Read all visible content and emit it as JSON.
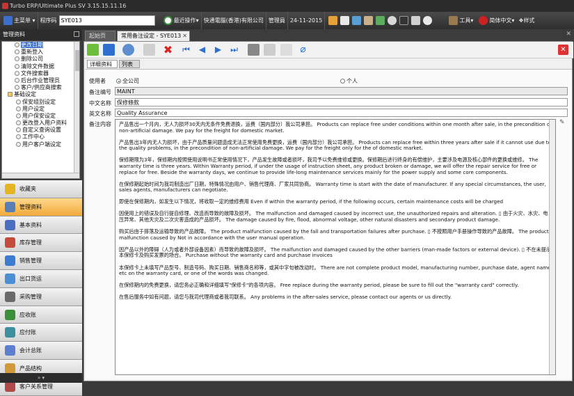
{
  "window": {
    "title": "Turbo ERP/Ultimate Plus SV 3.15.15.11.16"
  },
  "toolbar": {
    "main_menu": "主菜单",
    "program_code_label": "程序码",
    "program_code_value": "SYE013",
    "recent_ops": "最近操作",
    "company": "快通電腦(香港)有限公司",
    "user": "管理員",
    "date": "24-11-2015",
    "tools": "工具",
    "language": "简体中文",
    "style": "样式"
  },
  "sidebar": {
    "title": "管理资料",
    "tree": [
      {
        "label": "更改日期",
        "selected": true
      },
      {
        "label": "重新登入"
      },
      {
        "label": "删除公司"
      },
      {
        "label": "清除文件数据"
      },
      {
        "label": "文件搜索器"
      },
      {
        "label": "后台作业管理员"
      },
      {
        "label": "客户/供应商搜索"
      },
      {
        "label": "基础设定"
      },
      {
        "label": "保安组别设定"
      },
      {
        "label": "用户设定"
      },
      {
        "label": "用户保安设定"
      },
      {
        "label": "更改登入用户资料"
      },
      {
        "label": "自定义查询设置"
      },
      {
        "label": "工作中心"
      },
      {
        "label": "用户客户端设定"
      }
    ],
    "modules": [
      {
        "label": "收藏夹",
        "color": "#e6b422"
      },
      {
        "label": "管理资料",
        "color": "#5a7fb5",
        "active": true
      },
      {
        "label": "基本资料",
        "color": "#4a6fc0"
      },
      {
        "label": "库存管理",
        "color": "#c44b3c"
      },
      {
        "label": "销售管理",
        "color": "#3b7bd0"
      },
      {
        "label": "出口货运",
        "color": "#4b8fd6"
      },
      {
        "label": "采购管理",
        "color": "#6a6a6a"
      },
      {
        "label": "应收账",
        "color": "#3b8f3b"
      },
      {
        "label": "应付账",
        "color": "#3b8f9f"
      },
      {
        "label": "会计总账",
        "color": "#5c7fd0"
      },
      {
        "label": "产品结构",
        "color": "#d09a3b"
      },
      {
        "label": "客户关系管理",
        "color": "#b04a4a"
      }
    ]
  },
  "doc_tabs": {
    "home": "起始页",
    "current": "常用备注设定 - SYE013"
  },
  "sub_tabs": {
    "detail": "详细资料",
    "list": "列表"
  },
  "form": {
    "usage_label": "使用者",
    "opt_all": "全公司",
    "opt_personal": "个人",
    "code_label": "备注编号",
    "code_value": "MAINT",
    "name_cn_label": "中文名称",
    "name_cn_value": "保修條款",
    "name_en_label": "英文名称",
    "name_en_value": "Quality Assurance",
    "content_label": "备注内容",
    "content": [
      "产品售出一个月内，无人为损坏30天内无条件免费退换，运费（国内部分）我公司承担。 Products can replace free under conditions within one month after sale, in the precondition of non-artificial damage. We pay for the freight for domestic market.",
      "产品售出3年内无人为损坏，由于产品质量问题造成无法正常使用免费更换，运费（国内部分）我公司承担。 Products can replace free within three years after sale if it cannot use due to the quality problems, in the precondition of non-artificial damage. We pay for the freight only for the of domestic market.",
      "保修期限为3年，保修期内按照使用说明书正常使用情况下，产品发生故障或者损坏，我司予以免费维修或更换。保修期后进行终身的有偿维护，主要涉及电源及核心部件的更换或维修。 The warranty time is three years. Within Warranty period, if under the usage of instruction sheet, any product broken or damage, we will offer the repair service for free or replace for free. Beside the warranty days, we continue to provide life-long maintenance services mainly for the power supply and some core components.",
      "在保修期起始时间为我司制造出厂日期，特殊情况由用户、销售代理商、厂家共同协商。 Warranty time is start with the date of manufacturer. If any special circumstances, the user, sales agents, manufacturers can negotiate.",
      "即使在保修期内，如发生以下情况，将收取一定的维修费用 Even if within the warranty period, if the following occurs, certain maintenance costs will be charged",
      "因使用上的错误及自行提自修理、改造而导致的故障及损坏。 The malfunction and damaged caused by incorrect use, the unauthorized repairs and alteration. ▯ 由于火灾、水灾、电压异常、其他天灾及二次灾害造成的产品损坏。 The damage caused by fire, flood, abnormal voltage, other natural disasters and secondary product damage.",
      "购买后由于摔落及运输导致的产品故障。 The product malfunction caused by the fall and transportation failures after purchase. ▯ 不按照用户手册操作导致的产品故障。 The product malfunction caused by Not in accordance with the user manual operation.",
      "因产品以外的障碍（人为或者外部设备因素）而导致的故障及损坏。 The malfunction and damaged caused by the other barriers (man-made factors or external device). ▯ 不在未提示本保修卡及购买发票的场合。 Purchase without the warranty card and purchase invoices",
      "本保修卡上未填写产品型号、制造号码、购买日期、销售商名称等，或其中字句被改动时。 There are not complete product model, manufacturing number, purchase date, agent name etc on the warranty card, or one of the words was changed.",
      "在保修期内的免费更换，请您务必正确和详细填写\"保修卡\"的各项内容。 Free replace during the warranty period, please be sure to fill out the \"warranty card\" correctly.",
      "在售后服务中如有问题，请您与我司代理商或者我司联系。 Any problems in the after-sales service, please contact our agents or us directly."
    ]
  },
  "colors": {
    "accent": "#3169c6",
    "active_module": "#f1a93a"
  }
}
